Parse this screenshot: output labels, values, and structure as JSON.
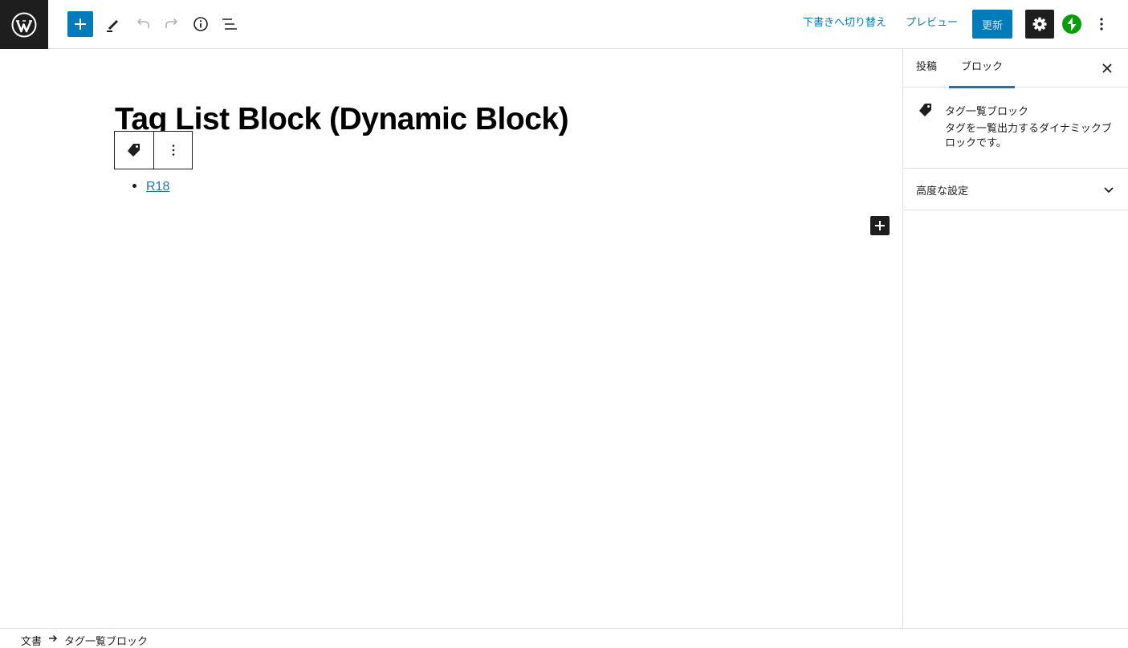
{
  "header": {
    "switch_to_draft": "下書きへ切り替え",
    "preview": "プレビュー",
    "update": "更新"
  },
  "editor": {
    "title": "Tag List Block (Dynamic Block)",
    "tags": [
      "R18"
    ]
  },
  "sidebar": {
    "tabs": [
      {
        "label": "投稿",
        "active": false
      },
      {
        "label": "ブロック",
        "active": true
      }
    ],
    "block_card": {
      "title": "タグ一覧ブロック",
      "description": "タグを一覧出力するダイナミックブロックです。"
    },
    "panels": [
      {
        "title": "高度な設定"
      }
    ]
  },
  "footer": {
    "breadcrumb": [
      "文書",
      "タグ一覧ブロック"
    ]
  },
  "colors": {
    "accent": "#007cba",
    "dark": "#1e1e1e",
    "jetpack": "#069e08",
    "link": "#2271b1"
  }
}
